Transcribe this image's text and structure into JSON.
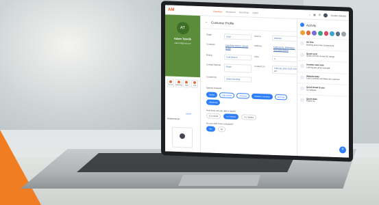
{
  "app": {
    "logo": "AM",
    "nav": [
      "Overview",
      "Workforce",
      "Incentives",
      "Leads"
    ],
    "user": "Charles Oriented"
  },
  "profile": {
    "initials": "AT",
    "name": "Adam Taiwiik",
    "email": "adam.t@gmail.com"
  },
  "quick_actions": [
    "Email",
    "Meeting",
    "Note",
    "Call"
  ],
  "left": {
    "section": "Relationships",
    "toggle": "Active"
  },
  "main": {
    "title": "Customer Profile",
    "fields": [
      {
        "label": "Stage",
        "value": "Lead"
      },
      {
        "label": "Source",
        "value": "Website"
      },
      {
        "label": "Company",
        "value": "Sub-Point Motion Sensor Retail"
      },
      {
        "label": "Address",
        "value": "Kathmandu, Bhaktapur, New Baneshwor"
      },
      {
        "label": "Rating",
        "value": "Cold Breeze"
      },
      {
        "label": "Zone",
        "value": "A"
      },
      {
        "label": "Contact Method",
        "value": "Email"
      },
      {
        "label": "Created On",
        "value": "February 20th 2023 2:00 pm"
      },
      {
        "label": "Created By",
        "value": "Online Booking"
      }
    ],
    "interest_label": "Special Interests",
    "chips": [
      {
        "label": "Dental",
        "on": true
      },
      {
        "label": "Adjustment",
        "on": false
      },
      {
        "label": "Stomach",
        "on": false
      },
      {
        "label": "Pediatric Dentistry",
        "on": true
      },
      {
        "label": "Fluoride",
        "on": false
      },
      {
        "label": "Whitening",
        "on": true
      }
    ],
    "q1": "How soon are you able to book?",
    "q1_opts": [
      {
        "label": "In a month",
        "on": false
      },
      {
        "label": "In 2 Weeks",
        "on": true
      },
      {
        "label": "In 2 Weeks",
        "on": false
      }
    ],
    "q2": "Do you wish to be contacted?",
    "q2_opts": [
      {
        "label": "Yes",
        "on": true
      },
      {
        "label": "No",
        "on": false
      }
    ]
  },
  "activity": {
    "title": "Activity",
    "colors": [
      "#f0a23a",
      "#e26d3b",
      "#7b6bd8",
      "#3aa58a",
      "#e0465f",
      "#3ba3d6",
      "#5b6f82",
      "#9aa2ab"
    ],
    "items": [
      {
        "title": "On Site",
        "text": "Meeting about New Government"
      },
      {
        "title": "Quote sent",
        "text": "Quote with the revised 3D design"
      },
      {
        "title": "Another task note",
        "text": "Call Rayaan about estimate"
      },
      {
        "title": "Website Note",
        "text": "Look a website with filters the customer"
      },
      {
        "title": "Quick Email to you",
        "text": "On Website"
      },
      {
        "title": "Quick Note",
        "text": "Follow-Up"
      }
    ]
  }
}
